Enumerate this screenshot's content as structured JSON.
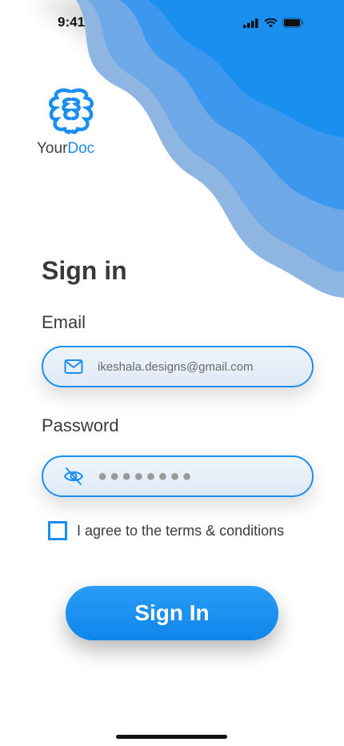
{
  "status_bar": {
    "time": "9:41"
  },
  "logo": {
    "name_part1": "Your",
    "name_part2": "Doc"
  },
  "form": {
    "title": "Sign in",
    "email_label": "Email",
    "email_value": "ikeshala.designs@gmail.com",
    "password_label": "Password",
    "password_value": "●●●●●●●●",
    "agree_text": "I agree to the terms & conditions",
    "agree_checked": false,
    "submit_label": "Sign In"
  },
  "colors": {
    "accent": "#1a8ff0",
    "wave_light": "#8ab8e8",
    "wave_dark": "#1a8ff0"
  },
  "icons": {
    "email": "mail-icon",
    "password": "eye-off-icon",
    "logo": "brain-icon"
  }
}
